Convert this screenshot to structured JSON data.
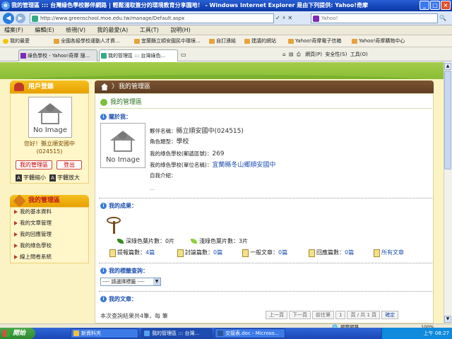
{
  "window": {
    "title": "我的管理區 ::: 台灣綠色學校夥伴網路 | 輕鬆淺取簽分的環境教育分享園地！ - Windows Internet Explorer 是由下列提供: Yahoo!奇摩",
    "ie_icon": "e"
  },
  "address": {
    "url": "http://www.greenschool.moe.edu.tw/manage/Default.aspx",
    "search_placeholder": "Yahoo!",
    "nav_controls": "✓ ⚡ ✕",
    "search_go": "🔍"
  },
  "menu": [
    "檔案(F)",
    "編輯(E)",
    "檢視(V)",
    "我的最愛(A)",
    "工具(T)",
    "說明(H)"
  ],
  "favorites": {
    "label": "我的最愛",
    "items": [
      "全國各級學校運動人才資...",
      "宜蘭縣立順安國民中環境...",
      "自訂連結",
      "建議的網站",
      "Yahoo!奇摩電子信箱",
      "Yahoo!奇摩購物中心"
    ]
  },
  "tabs": [
    {
      "label": "綠色學校 - Yahoo!奇摩 搜...",
      "active": false
    },
    {
      "label": "我的管理區 ::: 台灣綠色...",
      "active": true
    }
  ],
  "command_bar": {
    "page": "網頁(P)",
    "safety": "安全性(S)",
    "tools": "工具(O)"
  },
  "sidebar": {
    "login_title": "用戶登錄",
    "no_image": "No Image",
    "hello": "您好！縣立順安國中",
    "user_id": "(024515)",
    "my_area_button": "我的管理區",
    "logout_button": "登出",
    "font_smaller": "字體縮小",
    "font_larger": "字體放大",
    "mgr_title": "我的管理區",
    "mgr_items": [
      "我的基本資料",
      "我的文章管理",
      "我的回應管理",
      "我的綠色學校",
      "線上問卷系統"
    ]
  },
  "main": {
    "header": "我的管理區",
    "arrow": "〉",
    "section_title": "我的管理區",
    "about": {
      "heading": "關於我：",
      "no_image": "No Image",
      "role_name_label": "夥伴名稱：",
      "role_name": "縣立順安國中(024515)",
      "role_type_label": "角色類型：",
      "role_type": "學校",
      "postal_label": "我的綠色學校(郵遞區號)：",
      "postal": "269",
      "unit_label": "我的綠色學校(單位名稱)：",
      "unit": "宜蘭縣冬山鄉順安國中",
      "intro_label": "自我介紹：",
      "intro_value": "..."
    },
    "results": {
      "heading": "我的成果：",
      "dark_leaves_label": "深綠色葉片數：",
      "dark_leaves": "0片",
      "light_leaves_label": "淺綠色葉片數：",
      "light_leaves": "3片",
      "proposals_label": "提報篇數：",
      "proposals": "4篇",
      "discussions_label": "討論篇數：",
      "discussions": "0篇",
      "general_label": "一般文章：",
      "general": "0篇",
      "replies_label": "回應篇數：",
      "replies": "0篇",
      "all_articles": "所有文章"
    },
    "tags": {
      "heading": "我的標籤查詢：",
      "select_value": "---- 請選擇標籤 ----"
    },
    "articles": {
      "heading": "我的文章：",
      "bottom_text": "本次查詢結果共4筆，每 筆",
      "pager": [
        "上一頁",
        "下一頁",
        "前往第",
        "1",
        "頁 / 共 1 頁",
        "確定"
      ]
    }
  },
  "status_bar": {
    "zone": "網際網路",
    "zoom": "100%"
  },
  "taskbar": {
    "start": "開始",
    "tasks": [
      "新資料夾",
      "我的管理區 ::: 台灣...",
      "交接表.doc - Microso..."
    ],
    "clock": "上午 08:27"
  },
  "colors": {
    "accent_brown": "#5f3d22",
    "accent_green": "#8abd35",
    "accent_yellow": "#e8a000",
    "link_blue": "#1d4fb0"
  }
}
